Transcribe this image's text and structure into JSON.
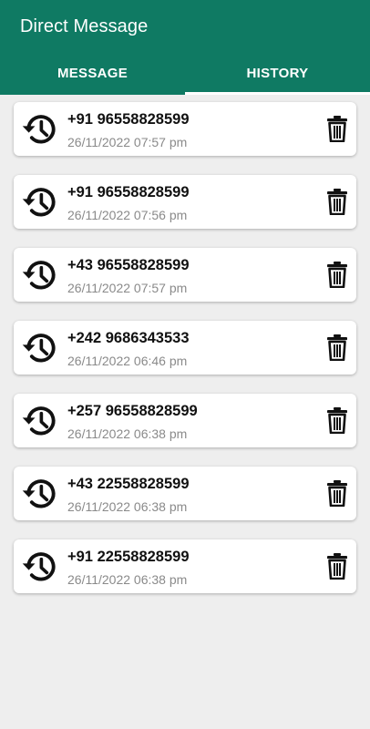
{
  "app": {
    "title": "Direct Message"
  },
  "tabs": [
    {
      "label": "MESSAGE",
      "selected": false
    },
    {
      "label": "HISTORY",
      "selected": true
    }
  ],
  "colors": {
    "appbar": "#0f7a63",
    "background": "#eeeeee",
    "card": "#ffffff"
  },
  "icons": {
    "entry": "history-icon",
    "action": "trash-icon"
  },
  "history": [
    {
      "number": "+91 96558828599",
      "datetime": "26/11/2022 07:57 pm"
    },
    {
      "number": "+91 96558828599",
      "datetime": "26/11/2022 07:56 pm"
    },
    {
      "number": "+43 96558828599",
      "datetime": "26/11/2022 07:57 pm"
    },
    {
      "number": "+242 9686343533",
      "datetime": "26/11/2022 06:46 pm"
    },
    {
      "number": "+257 96558828599",
      "datetime": "26/11/2022 06:38 pm"
    },
    {
      "number": "+43 22558828599",
      "datetime": "26/11/2022 06:38 pm"
    },
    {
      "number": "+91 22558828599",
      "datetime": "26/11/2022 06:38 pm"
    }
  ]
}
